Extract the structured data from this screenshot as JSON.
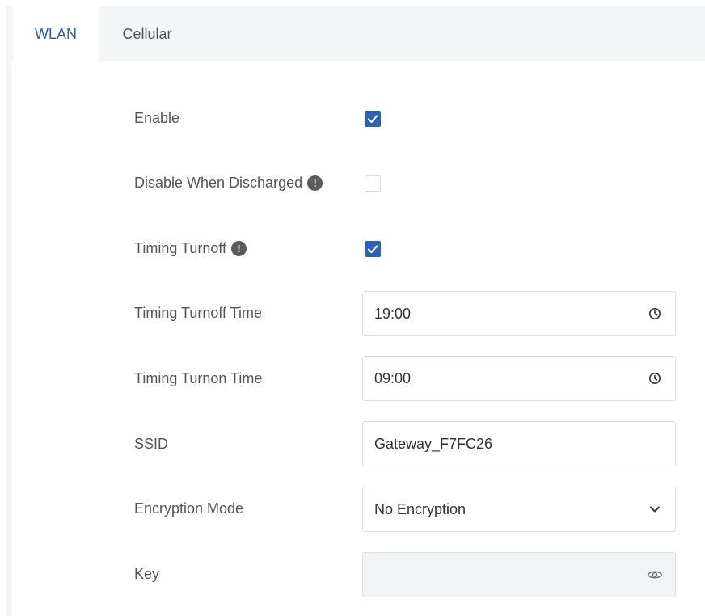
{
  "tabs": [
    {
      "label": "WLAN",
      "active": true
    },
    {
      "label": "Cellular",
      "active": false
    }
  ],
  "form": {
    "enable": {
      "label": "Enable",
      "checked": true
    },
    "disable_when_discharged": {
      "label": "Disable When Discharged",
      "checked": false,
      "icon": "info-icon"
    },
    "timing_turnoff": {
      "label": "Timing Turnoff",
      "checked": true,
      "icon": "info-icon"
    },
    "timing_turnoff_time": {
      "label": "Timing Turnoff Time",
      "value": "19:00",
      "icon": "clock-icon"
    },
    "timing_turnon_time": {
      "label": "Timing Turnon Time",
      "value": "09:00",
      "icon": "clock-icon"
    },
    "ssid": {
      "label": "SSID",
      "value": "Gateway_F7FC26"
    },
    "encryption_mode": {
      "label": "Encryption Mode",
      "value": "No Encryption",
      "icon": "chevron-down-icon"
    },
    "key": {
      "label": "Key",
      "value": "",
      "icon": "eye-icon"
    }
  },
  "colors": {
    "accent": "#2a62b8",
    "active_tab_text": "#2c5ea8"
  }
}
